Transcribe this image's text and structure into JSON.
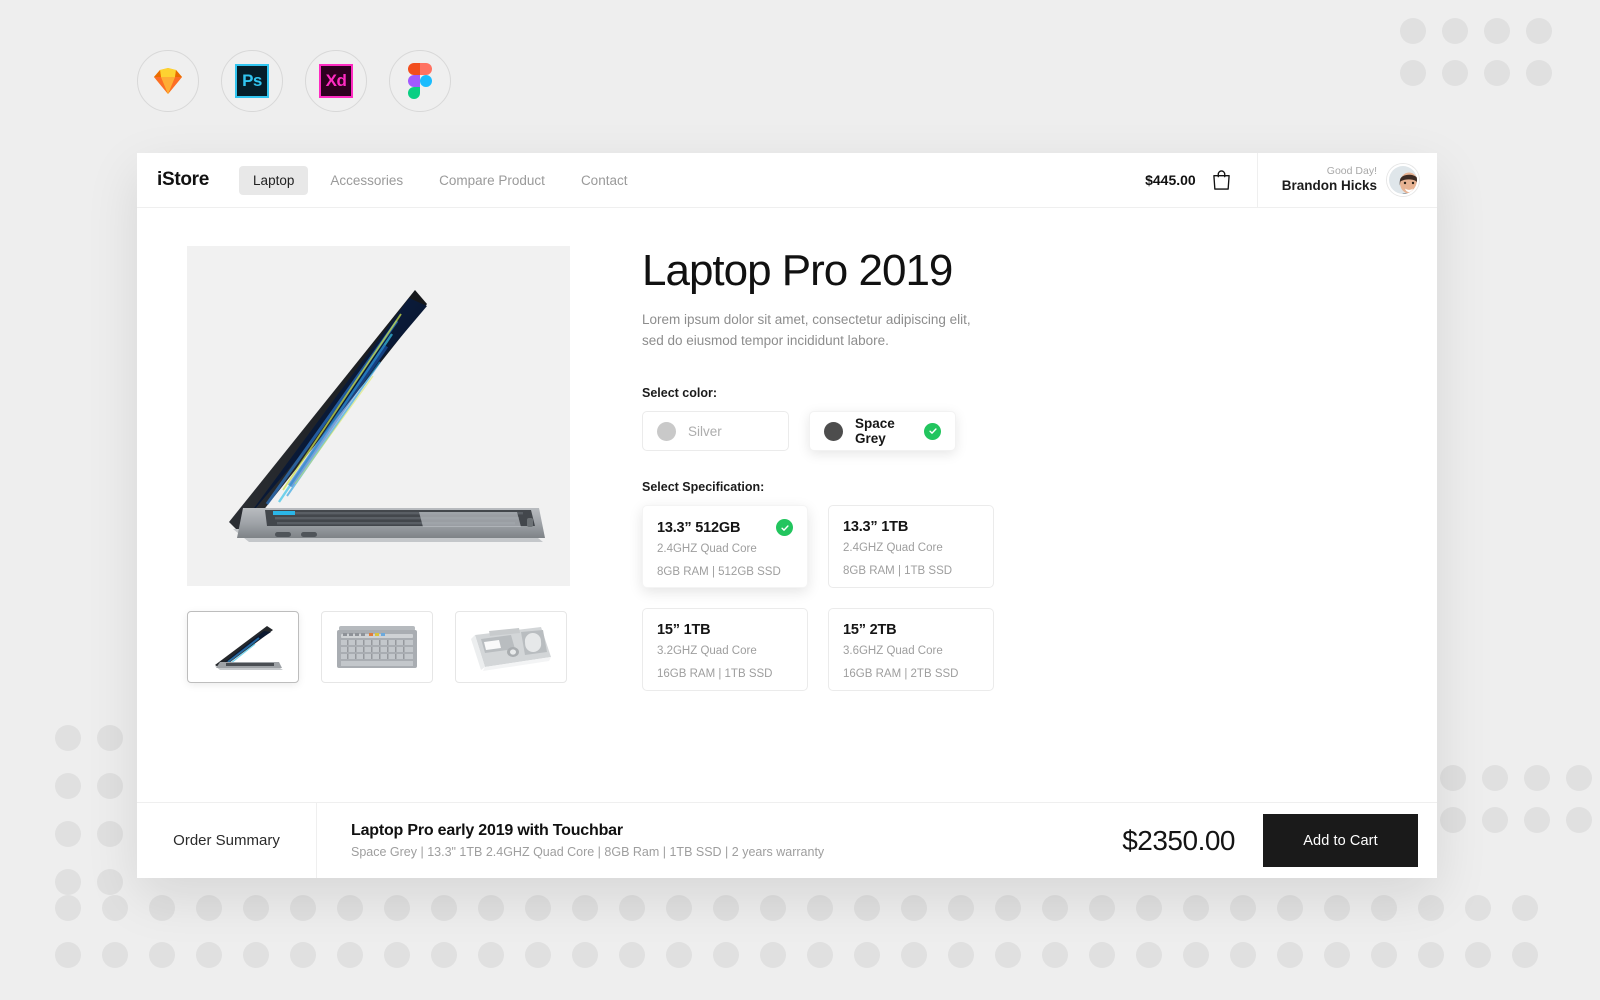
{
  "app_icons": [
    {
      "name": "sketch-icon",
      "label": "Sketch"
    },
    {
      "name": "photoshop-icon",
      "label": "Ps"
    },
    {
      "name": "adobe-xd-icon",
      "label": "Xd"
    },
    {
      "name": "figma-icon",
      "label": "Figma"
    }
  ],
  "nav": {
    "brand": "iStore",
    "links": [
      {
        "label": "Laptop",
        "active": true
      },
      {
        "label": "Accessories",
        "active": false
      },
      {
        "label": "Compare Product",
        "active": false
      },
      {
        "label": "Contact",
        "active": false
      }
    ],
    "cart_amount": "$445.00",
    "cart_icon": "shopping-bag-icon",
    "greeting": "Good Day!",
    "user_name": "Brandon Hicks"
  },
  "product": {
    "title": "Laptop Pro 2019",
    "description": "Lorem ipsum dolor sit amet, consectetur adipiscing elit, sed do eiusmod tempor incididunt labore.",
    "gallery": [
      {
        "alt": "laptop-side-view",
        "selected": true
      },
      {
        "alt": "laptop-keyboard-top-view",
        "selected": false
      },
      {
        "alt": "laptop-packaging-tray",
        "selected": false
      }
    ]
  },
  "color_section": {
    "label": "Select color:",
    "options": [
      {
        "name": "Silver",
        "swatch": "#c9c9c9",
        "selected": false
      },
      {
        "name": "Space Grey",
        "swatch": "#4d4d4d",
        "selected": true
      }
    ]
  },
  "spec_section": {
    "label": "Select Specification:",
    "options": [
      {
        "title": "13.3” 512GB",
        "cpu": "2.4GHZ Quad Core",
        "mem": "8GB RAM | 512GB SSD",
        "selected": true
      },
      {
        "title": "13.3” 1TB",
        "cpu": "2.4GHZ Quad Core",
        "mem": "8GB RAM | 1TB SSD",
        "selected": false
      },
      {
        "title": "15” 1TB",
        "cpu": "3.2GHZ Quad Core",
        "mem": "16GB RAM | 1TB SSD",
        "selected": false
      },
      {
        "title": "15” 2TB",
        "cpu": "3.6GHZ Quad Core",
        "mem": "16GB RAM | 2TB SSD",
        "selected": false
      }
    ]
  },
  "summary": {
    "label": "Order Summary",
    "title": "Laptop Pro early 2019 with Touchbar",
    "details": "Space Grey | 13.3\" 1TB 2.4GHZ Quad Core | 8GB Ram | 1TB SSD | 2 years warranty",
    "price": "$2350.00",
    "cta": "Add to Cart"
  },
  "colors": {
    "accent_green": "#22c55e",
    "cta_bg": "#1a1a1a",
    "page_bg": "#eeeeee",
    "dot": "#e0e0e0"
  }
}
